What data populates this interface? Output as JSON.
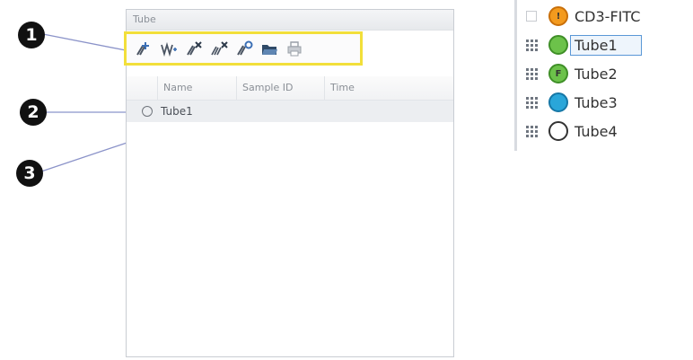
{
  "callouts": [
    "1",
    "2",
    "3"
  ],
  "panel": {
    "title": "Tube",
    "toolbar": [
      {
        "icon": "new-tube-icon"
      },
      {
        "icon": "acquisition-icon"
      },
      {
        "icon": "delete-tube-icon"
      },
      {
        "icon": "delete-all-icon"
      },
      {
        "icon": "tube-settings-icon"
      },
      {
        "icon": "open-folder-icon"
      },
      {
        "icon": "print-icon"
      }
    ],
    "columns": [
      "Name",
      "Sample ID",
      "Time"
    ],
    "rows": [
      {
        "name": "Tube1"
      }
    ]
  },
  "tube_list": [
    {
      "label": "CD3-FITC",
      "marker": "",
      "dot_letter": "!",
      "dot_color": "#f39a1e",
      "dot_style": "filled"
    },
    {
      "label": "Tube1",
      "marker": "grid",
      "dot_letter": "",
      "dot_color": "#6cc24a",
      "dot_style": "filled",
      "selected": true
    },
    {
      "label": "Tube2",
      "marker": "grid",
      "dot_letter": "F",
      "dot_color": "#6cc24a",
      "dot_style": "filled"
    },
    {
      "label": "Tube3",
      "marker": "grid",
      "dot_letter": "",
      "dot_color": "#2aa6d9",
      "dot_style": "filled"
    },
    {
      "label": "Tube4",
      "marker": "grid",
      "dot_letter": "",
      "dot_color": "#ffffff",
      "dot_style": "outline"
    }
  ]
}
